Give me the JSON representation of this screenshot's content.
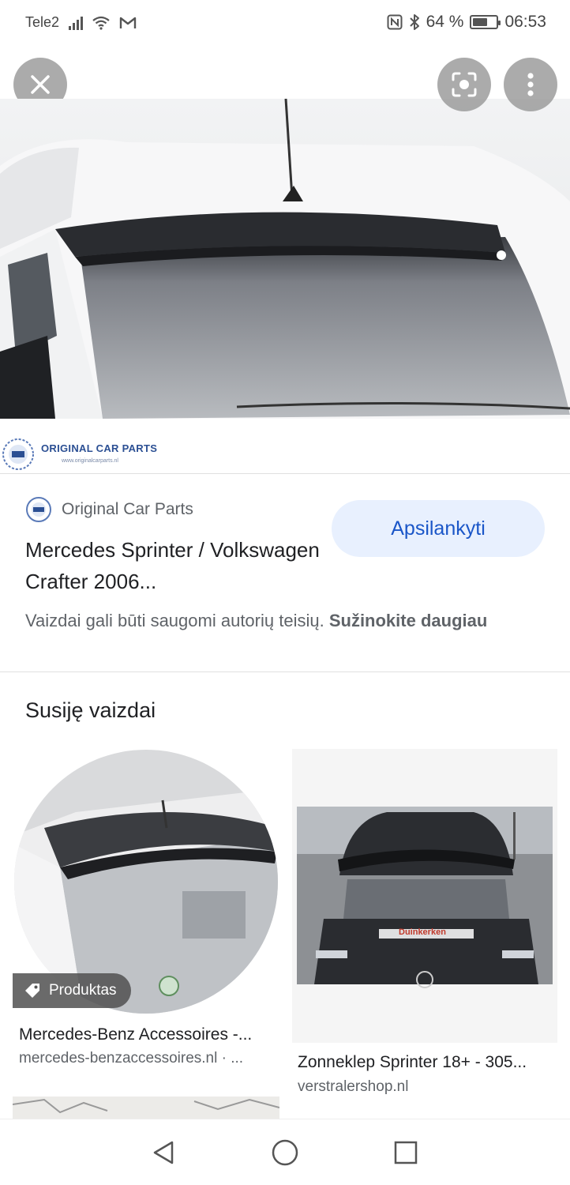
{
  "status_bar": {
    "carrier": "Tele2",
    "icons": [
      "signal-icon",
      "wifi-icon",
      "gmail-icon",
      "nfc-icon",
      "bluetooth-icon",
      "battery-icon"
    ],
    "battery": "64 %",
    "battery_level": 0.64,
    "time": "06:53"
  },
  "viewer": {
    "close_icon": "close-icon",
    "lens_icon": "lens-icon",
    "menu_icon": "more-vert-icon",
    "hero_logo_text": "ORIGINAL CAR PARTS",
    "hero_logo_sub": "www.originalcarparts.nl"
  },
  "result": {
    "source_name": "Original Car Parts",
    "title": "Mercedes Sprinter / Volkswagen Crafter 2006...",
    "visit_button": "Apsilankyti",
    "copyright_text": "Vaizdai gali būti saugomi autorių teisių.",
    "learn_more": "Sužinokite daugiau"
  },
  "related": {
    "heading": "Susiję vaizdai",
    "items": [
      {
        "title": "Mercedes-Benz Accessoires -...",
        "domain": "mercedes-benzaccessoires.nl · ...",
        "badge": "Produktas"
      },
      {
        "title": "Zonneklep Sprinter 18+ - 305...",
        "domain": "verstralershop.nl",
        "van_text": "Duinkerken"
      }
    ]
  },
  "nav": {
    "back": "back-icon",
    "home": "home-icon",
    "recents": "recents-icon"
  },
  "colors": {
    "accent_blue": "#1a56c8",
    "visit_bg": "#e8f0fe",
    "text_primary": "#202124",
    "text_secondary": "#5f6368"
  }
}
